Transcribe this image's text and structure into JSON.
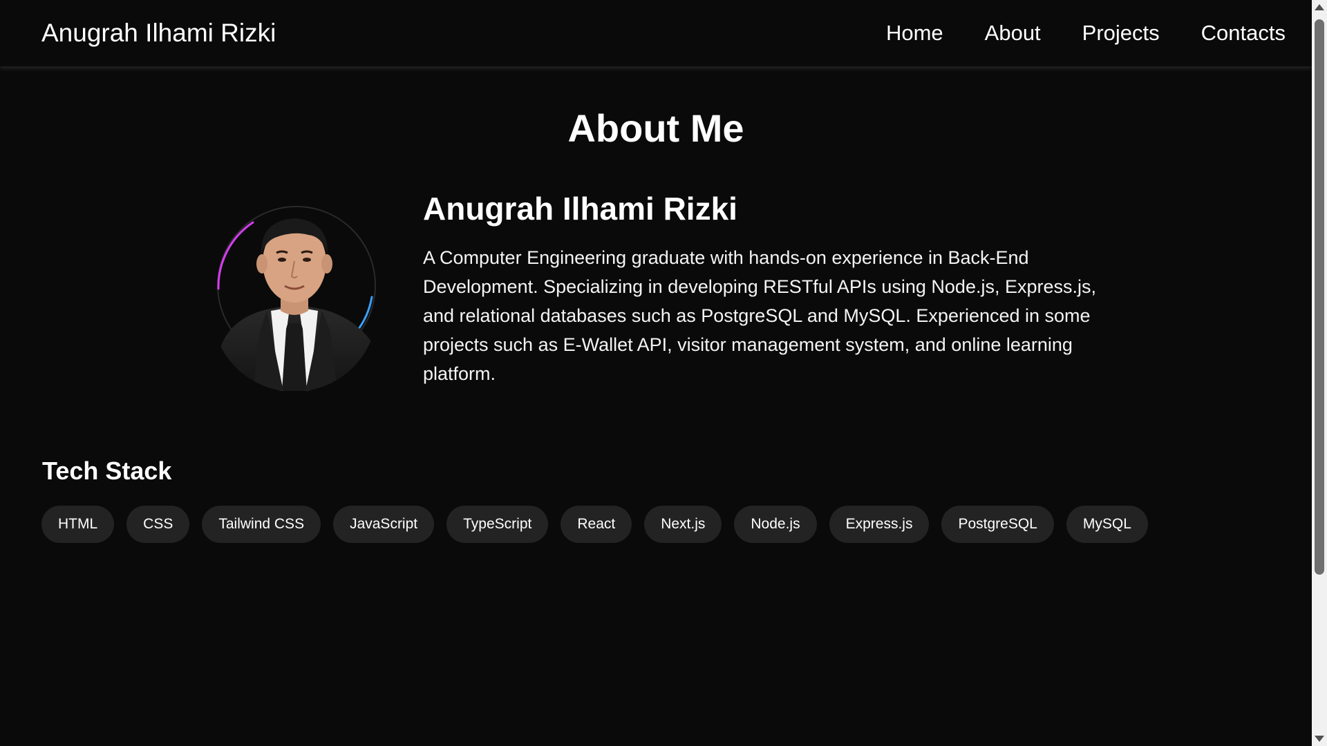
{
  "navbar": {
    "brand": "Anugrah Ilhami Rizki",
    "links": [
      "Home",
      "About",
      "Projects",
      "Contacts"
    ]
  },
  "about": {
    "title": "About Me",
    "name": "Anugrah Ilhami Rizki",
    "bio": "A Computer Engineering graduate with hands-on experience in Back-End Development. Specializing in developing RESTful APIs using Node.js, Express.js, and relational databases such as PostgreSQL and MySQL. Experienced in some projects such as E-Wallet API, visitor management system, and online learning platform.",
    "avatar_icon": "profile-photo"
  },
  "tech_stack": {
    "title": "Tech Stack",
    "items": [
      "HTML",
      "CSS",
      "Tailwind CSS",
      "JavaScript",
      "TypeScript",
      "React",
      "Next.js",
      "Node.js",
      "Express.js",
      "PostgreSQL",
      "MySQL"
    ]
  },
  "colors": {
    "background": "#0a0a0a",
    "chip_background": "#232323",
    "ring_accent_1": "#d63cf0",
    "ring_accent_2": "#3aa0ff"
  }
}
